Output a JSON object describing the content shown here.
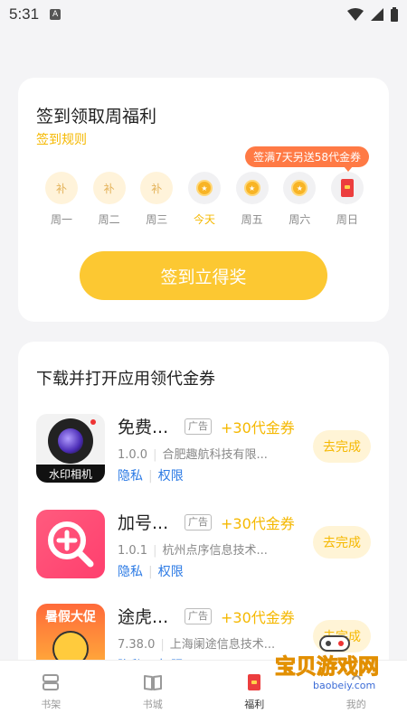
{
  "status_bar": {
    "time": "5:31",
    "notification_icon": "A"
  },
  "signin": {
    "title": "签到领取周福利",
    "rules_link": "签到规则",
    "promo_bubble": "签满7天另送58代金券",
    "days": [
      {
        "label": "周一",
        "state": "makeup",
        "mark": "补"
      },
      {
        "label": "周二",
        "state": "makeup",
        "mark": "补"
      },
      {
        "label": "周三",
        "state": "makeup",
        "mark": "补"
      },
      {
        "label": "今天",
        "state": "coin",
        "mark": ""
      },
      {
        "label": "周五",
        "state": "coin",
        "mark": ""
      },
      {
        "label": "周六",
        "state": "coin",
        "mark": ""
      },
      {
        "label": "周日",
        "state": "red-packet",
        "mark": ""
      }
    ],
    "button_label": "签到立得奖"
  },
  "download_section": {
    "title": "下载并打开应用领代金券",
    "apps": [
      {
        "name": "免费...",
        "icon_text": "水印相机",
        "ad_tag": "广告",
        "reward": "+30代金券",
        "version": "1.0.0",
        "developer": "合肥趣航科技有限...",
        "privacy": "隐私",
        "permissions": "权限",
        "action": "去完成"
      },
      {
        "name": "加号...",
        "icon_text": "",
        "ad_tag": "广告",
        "reward": "+30代金券",
        "version": "1.0.1",
        "developer": "杭州点序信息技术...",
        "privacy": "隐私",
        "permissions": "权限",
        "action": "去完成"
      },
      {
        "name": "途虎...",
        "icon_text": "暑假大促",
        "ad_tag": "广告",
        "reward": "+30代金券",
        "version": "7.38.0",
        "developer": "上海阑途信息技术...",
        "privacy": "隐私",
        "permissions": "权限",
        "action": "去完成"
      }
    ]
  },
  "tabbar": {
    "tabs": [
      {
        "label": "书架",
        "active": false
      },
      {
        "label": "书城",
        "active": false
      },
      {
        "label": "福利",
        "active": true
      },
      {
        "label": "我的",
        "active": false
      }
    ]
  },
  "watermark": {
    "title": "宝贝游戏网",
    "url": "baobeiy.com"
  },
  "colors": {
    "accent": "#fcc832",
    "accent_text": "#f5b800",
    "promo": "#ff7a45",
    "link": "#2d7be5"
  }
}
